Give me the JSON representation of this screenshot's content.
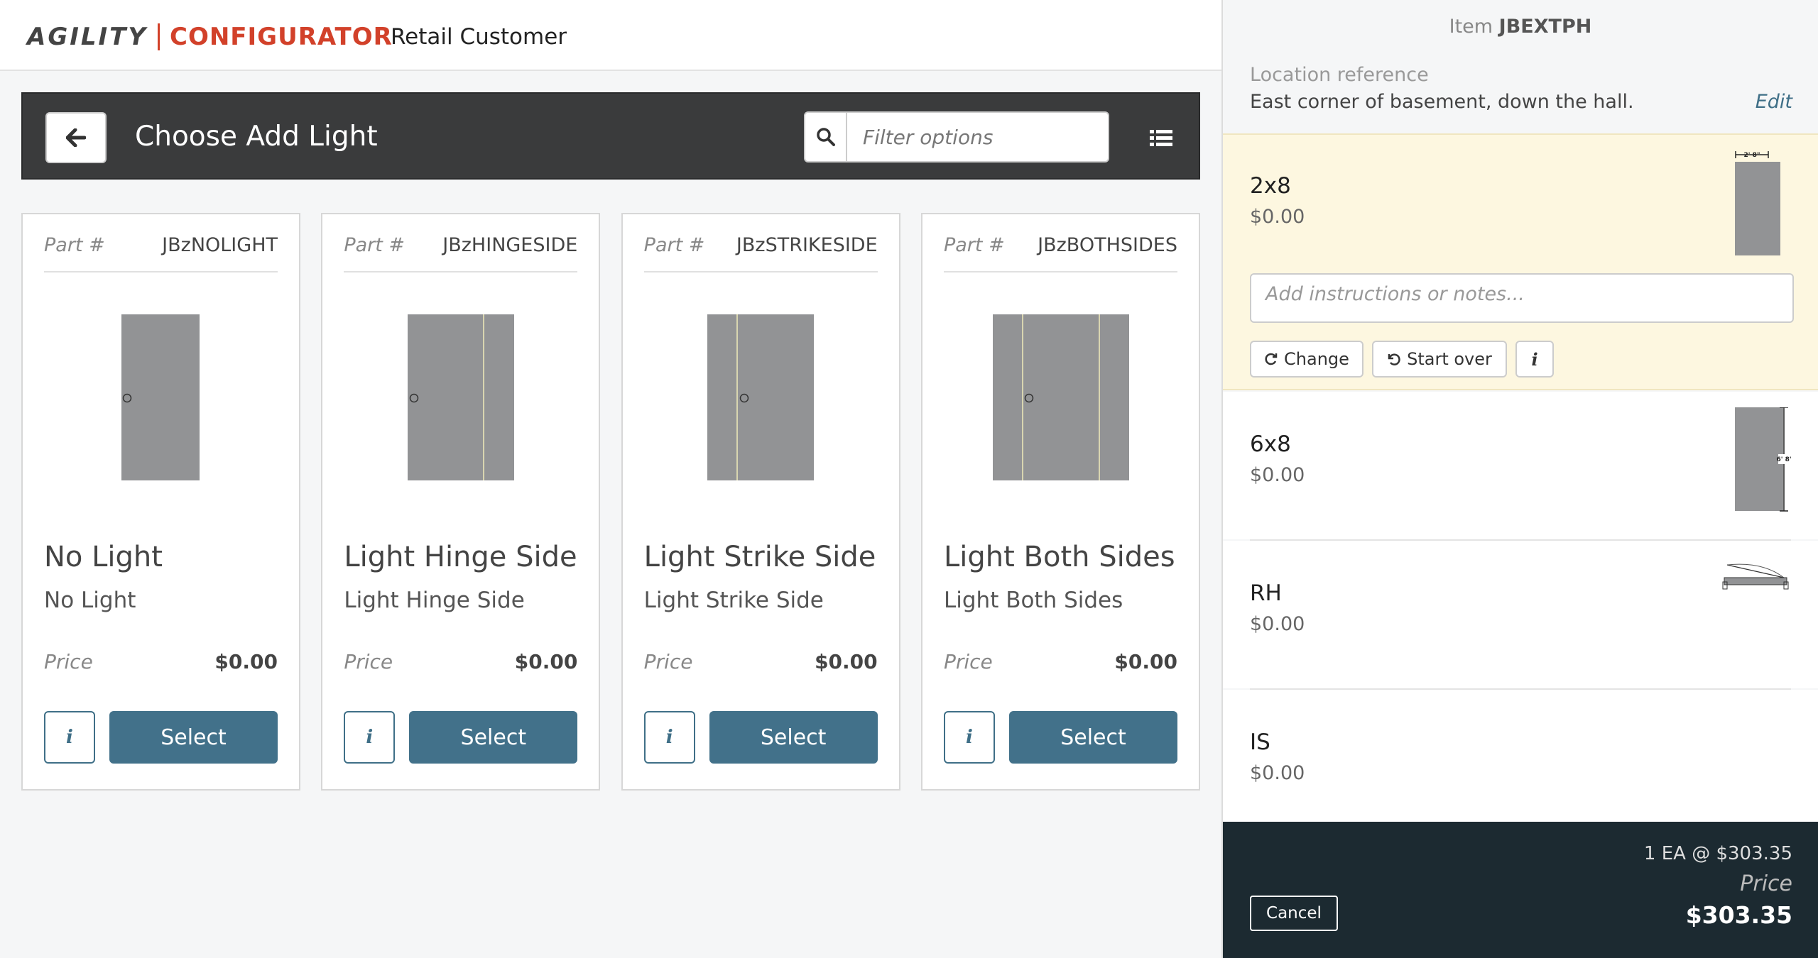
{
  "header": {
    "logo_agility": "AGILITY",
    "logo_configurator": "CONFIGURATOR",
    "customer": "Retail Customer"
  },
  "toolbar": {
    "title": "Choose Add Light",
    "filter_placeholder": "Filter options"
  },
  "cards": [
    {
      "part_label": "Part #",
      "part": "JBzNOLIGHT",
      "title": "No Light",
      "subtitle": "No Light",
      "price_label": "Price",
      "price": "$0.00",
      "select": "Select",
      "info": "i"
    },
    {
      "part_label": "Part #",
      "part": "JBzHINGESIDE",
      "title": "Light Hinge Side",
      "subtitle": "Light Hinge Side",
      "price_label": "Price",
      "price": "$0.00",
      "select": "Select",
      "info": "i"
    },
    {
      "part_label": "Part #",
      "part": "JBzSTRIKESIDE",
      "title": "Light Strike Side",
      "subtitle": "Light Strike Side",
      "price_label": "Price",
      "price": "$0.00",
      "select": "Select",
      "info": "i"
    },
    {
      "part_label": "Part #",
      "part": "JBzBOTHSIDES",
      "title": "Light Both Sides",
      "subtitle": "Light Both Sides",
      "price_label": "Price",
      "price": "$0.00",
      "select": "Select",
      "info": "i"
    }
  ],
  "panel": {
    "item_label": "Item",
    "item_code": "JBEXTPH",
    "location_label": "Location reference",
    "location_value": "East corner of basement, down the hall.",
    "edit": "Edit",
    "active_option": {
      "name": "2x8",
      "price": "$0.00",
      "dimension_label": "2' 8\"",
      "notes_placeholder": "Add instructions or notes...",
      "change": "Change",
      "start_over": "Start over",
      "info": "i"
    },
    "options": [
      {
        "name": "6x8",
        "price": "$0.00",
        "dimension_label": "6' 8\""
      },
      {
        "name": "RH",
        "price": "$0.00"
      },
      {
        "name": "IS",
        "price": "$0.00"
      }
    ],
    "footer": {
      "qty_line": "1 EA @ $303.35",
      "price_label": "Price",
      "total": "$303.35",
      "cancel": "Cancel"
    }
  },
  "colors": {
    "brand_red": "#d2412a",
    "accent_teal": "#42718a",
    "toolbar_bg": "#3a3b3c",
    "active_bg": "#fdf7e0",
    "footer_bg": "#1c2a31"
  }
}
